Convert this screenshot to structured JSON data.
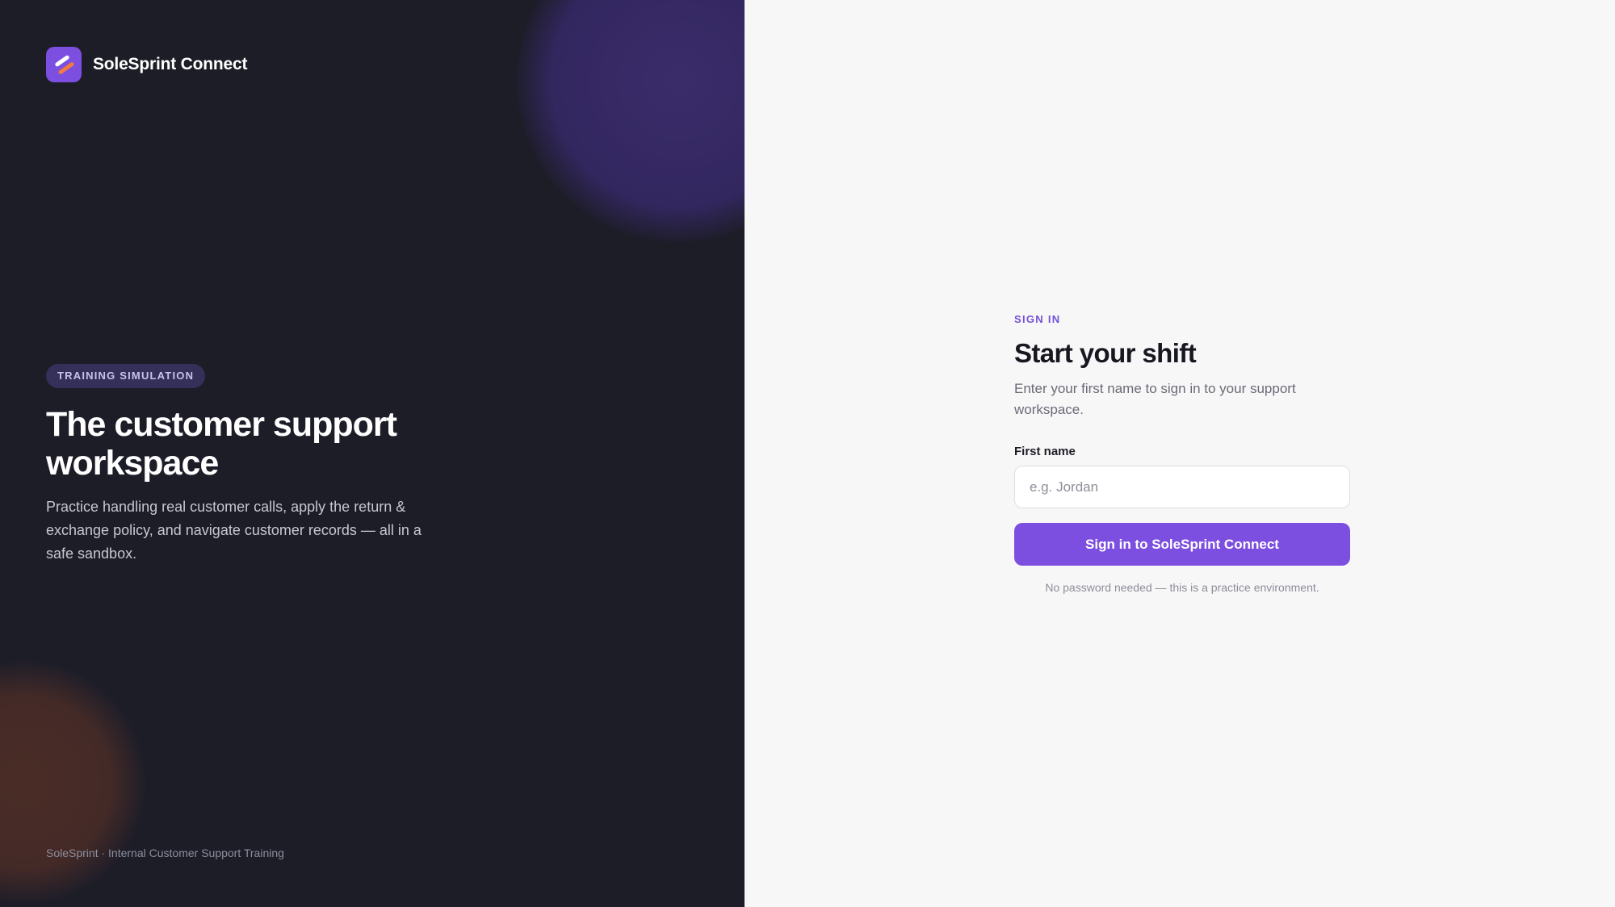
{
  "brand": {
    "name": "SoleSprint Connect",
    "icon": "solesprint-logo-icon"
  },
  "hero": {
    "badge": "TRAINING SIMULATION",
    "title": "The customer support workspace",
    "description": "Practice handling real customer calls, apply the return & exchange policy, and navigate customer records — all in a safe sandbox."
  },
  "footer": {
    "note": "SoleSprint · Internal Customer Support Training"
  },
  "signin": {
    "eyebrow": "SIGN IN",
    "title": "Start your shift",
    "subtitle": "Enter your first name to sign in to your support workspace.",
    "field_label": "First name",
    "field_value": "",
    "field_placeholder": "e.g. Jordan",
    "button_label": "Sign in to SoleSprint Connect",
    "hint": "No password needed — this is a practice environment."
  },
  "colors": {
    "accent": "#7c4fe0",
    "left_panel_bg": "#1d1d28",
    "right_panel_bg": "#f7f7f8",
    "logo_stripe": "#f27b3d"
  }
}
